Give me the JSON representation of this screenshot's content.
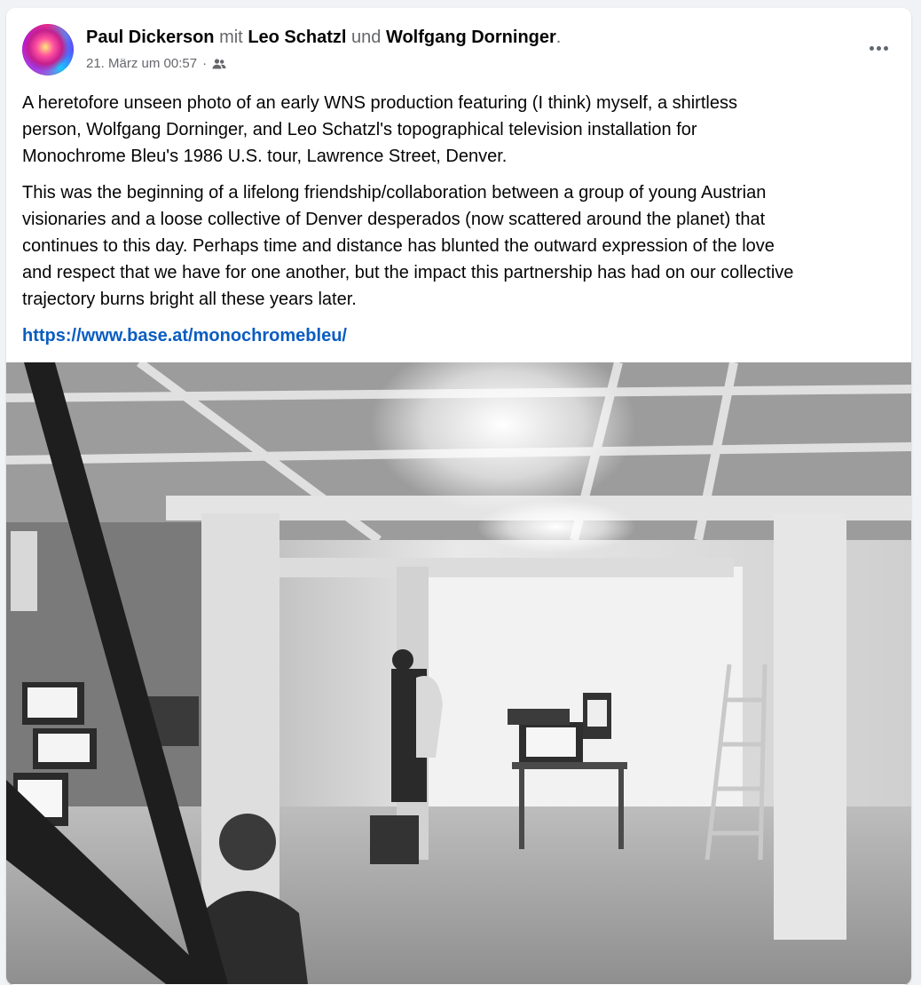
{
  "post": {
    "author": "Paul Dickerson",
    "with_word": "mit",
    "tagged_1": "Leo Schatzl",
    "and_word": "und",
    "tagged_2": "Wolfgang Dorninger",
    "period": ".",
    "timestamp": "21. März um 00:57",
    "separator": "·",
    "audience_icon": "friends-icon",
    "paragraph_1": "A heretofore unseen photo of an early WNS production featuring (I think) myself, a shirtless\nperson, Wolfgang Dorninger, and Leo Schatzl's topographical television installation for\nMonochrome Bleu's 1986 U.S. tour, Lawrence Street, Denver.",
    "paragraph_2": "This was the beginning of a lifelong friendship/collaboration between a group of young Austrian\nvisionaries and a loose collective of Denver desperados (now scattered around the planet) that\ncontinues to this day.  Perhaps time and distance has blunted the outward expression of the love\nand respect that we have for one another, but the impact this partnership has had on our collective\ntrajectory burns bright all these years later.",
    "link": "https://www.base.at/monochromebleu/"
  },
  "colors": {
    "link": "#0a5dc2",
    "secondary_text": "#65676b",
    "page_background": "#f0f2f5"
  },
  "icons": [
    "avatar",
    "friends-icon",
    "more-options-icon"
  ]
}
